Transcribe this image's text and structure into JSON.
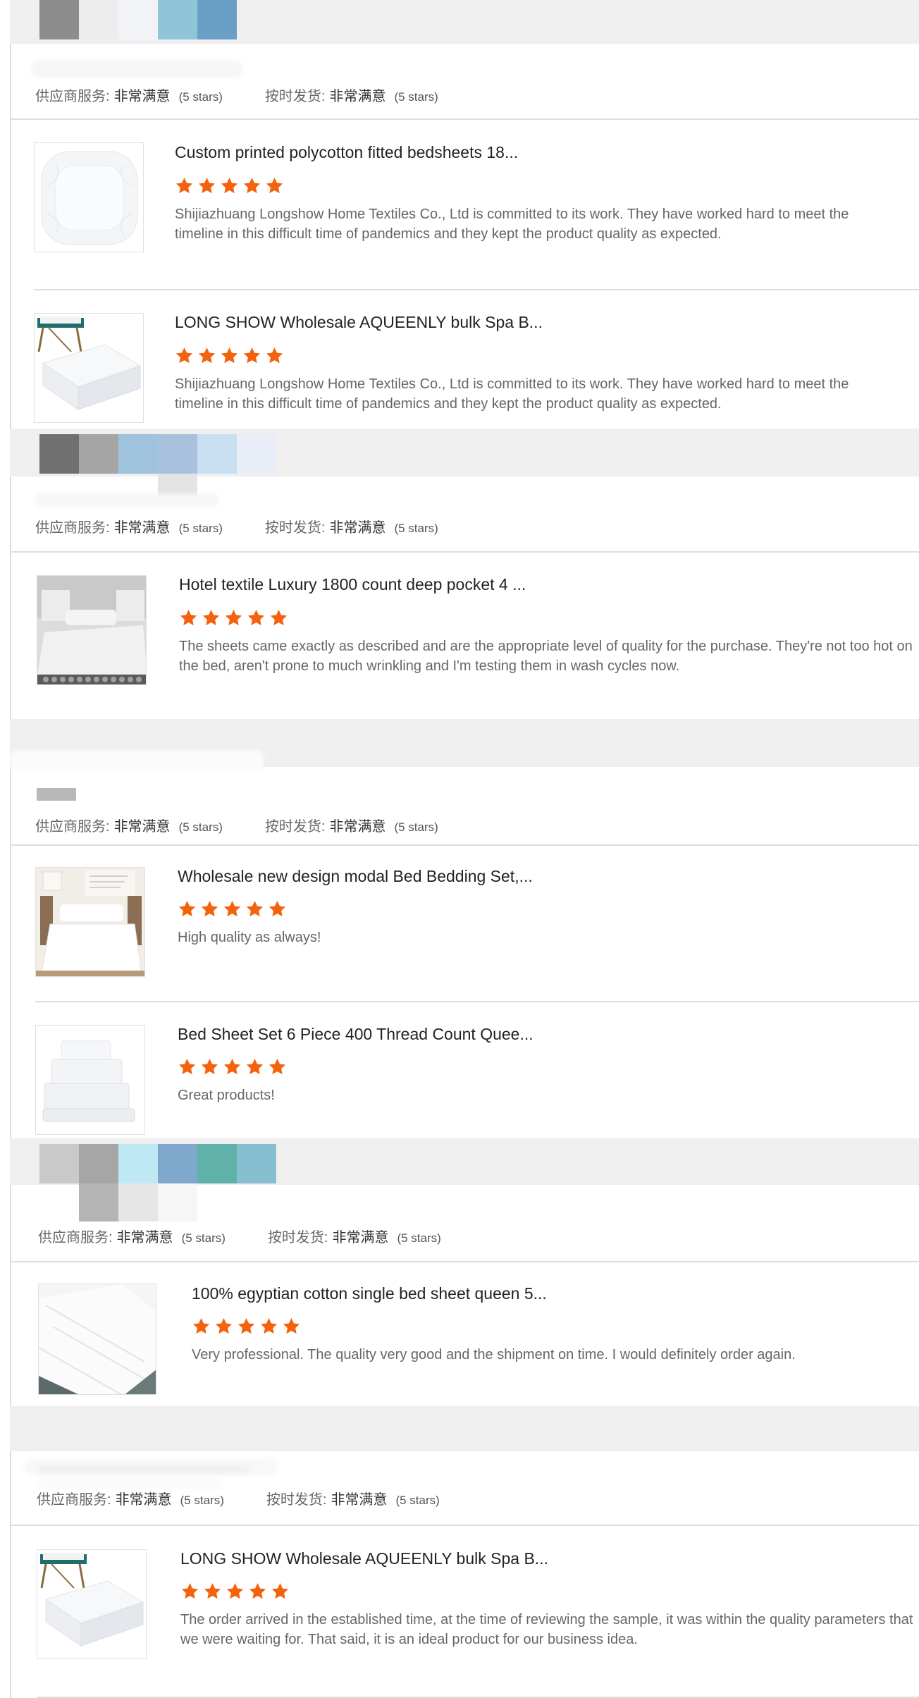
{
  "colors": {
    "star": "#f5620e",
    "bar": "#efefef",
    "divider": "#dedede"
  },
  "labels": {
    "supplier_service": "供应商服务:",
    "on_time_delivery": "按时发货:",
    "very_satisfied": "非常满意",
    "five_stars": "(5 stars)"
  },
  "reviews": [
    {
      "items": [
        {
          "title": "Custom printed polycotton fitted bedsheets 18...",
          "rating": 5,
          "comment": "Shijiazhuang Longshow Home Textiles Co., Ltd is committed to its work. They have worked hard to meet the timeline in this difficult time of pandemics and they kept the product quality as expected.",
          "thumb": "fitted-sheet"
        },
        {
          "title": "LONG SHOW Wholesale AQUEENLY bulk Spa B...",
          "rating": 5,
          "comment": "Shijiazhuang Longshow Home Textiles Co., Ltd is committed to its work. They have worked hard to meet the timeline in this difficult time of pandemics and they kept the product quality as expected.",
          "thumb": "spa-sheets"
        }
      ]
    },
    {
      "items": [
        {
          "title": "Hotel textile Luxury 1800 count deep pocket 4 ...",
          "rating": 5,
          "comment": "The sheets came exactly as described and are the appropriate level of quality for the purchase.  They're not too hot on the bed, aren't prone to much wrinkling and I'm testing them in wash cycles now.",
          "thumb": "hotel-bed"
        }
      ]
    },
    {
      "items": [
        {
          "title": "Wholesale new design modal Bed Bedding Set,...",
          "rating": 5,
          "comment": "High quality as always!",
          "thumb": "bedroom"
        },
        {
          "title": "Bed Sheet Set 6 Piece 400 Thread Count Quee...",
          "rating": 5,
          "comment": "Great products!",
          "thumb": "folded-stack"
        }
      ]
    },
    {
      "items": [
        {
          "title": "100% egyptian cotton single bed sheet queen 5...",
          "rating": 5,
          "comment": "Very professional. The quality very good and the shipment on time. I would definitely order again.",
          "thumb": "white-cloth"
        }
      ]
    },
    {
      "items": [
        {
          "title": "LONG SHOW Wholesale AQUEENLY bulk Spa B...",
          "rating": 5,
          "comment": "The order arrived in the established time, at the time of reviewing the sample, it was within the quality parameters that we were waiting for. That said, it is an ideal product for our business idea.",
          "thumb": "spa-sheets"
        }
      ]
    }
  ]
}
